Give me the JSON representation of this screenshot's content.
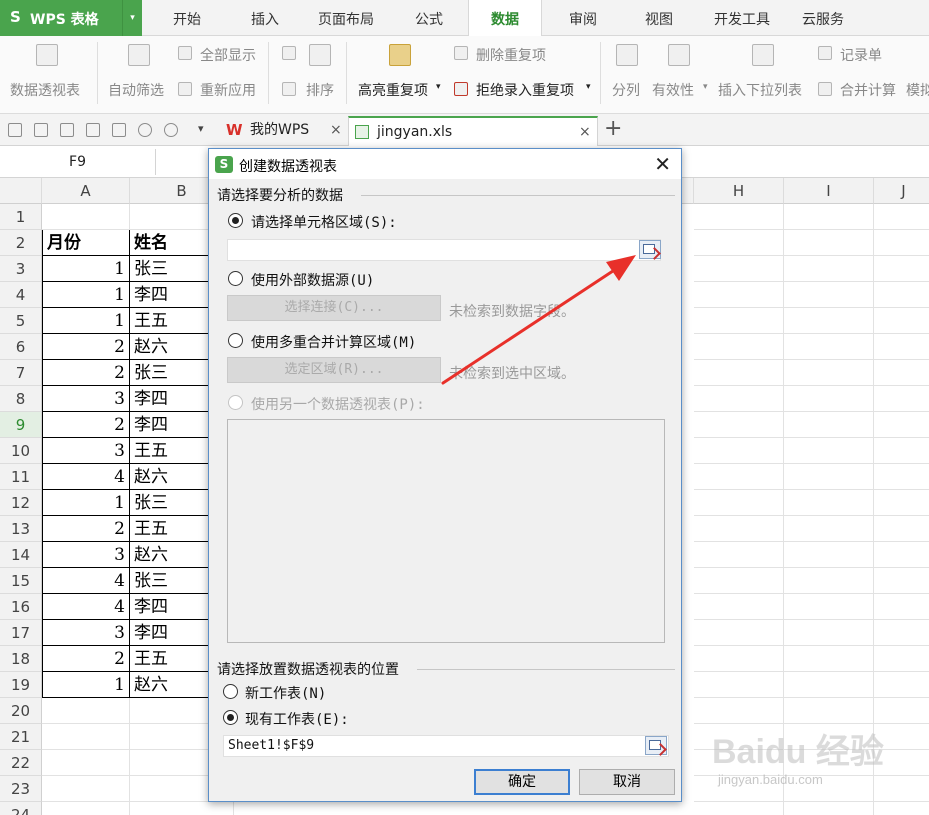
{
  "app": {
    "logo": "S",
    "name": "WPS 表格",
    "menu_arrow": "▾"
  },
  "ribbon_tabs": [
    "开始",
    "插入",
    "页面布局",
    "公式",
    "数据",
    "审阅",
    "视图",
    "开发工具",
    "云服务"
  ],
  "active_tab": "数据",
  "ribbon": {
    "pivot": "数据透视表",
    "autofilter": "自动筛选",
    "show_all": "全部显示",
    "reapply": "重新应用",
    "sort": "排序",
    "highlight_dup": "高亮重复项",
    "remove_dup": "删除重复项",
    "reject_dup": "拒绝录入重复项",
    "split": "分列",
    "validity": "有效性",
    "insert_dropdown": "插入下拉列表",
    "record": "记录单",
    "consolidate": "合并计算",
    "simulate": "模拟"
  },
  "doc_tabs": {
    "mywps": "我的WPS",
    "file": "jingyan.xls",
    "close": "×",
    "add": "+"
  },
  "formula_bar": {
    "name_box": "F9"
  },
  "columns": [
    "A",
    "B",
    "H",
    "I",
    "J"
  ],
  "rows": [
    "1",
    "2",
    "3",
    "4",
    "5",
    "6",
    "7",
    "8",
    "9",
    "10",
    "11",
    "12",
    "13",
    "14",
    "15",
    "16",
    "17",
    "18",
    "19",
    "20",
    "21",
    "22",
    "23",
    "24"
  ],
  "selected_row": "9",
  "table": {
    "headers": [
      "月份",
      "姓名"
    ],
    "data": [
      [
        "1",
        "张三"
      ],
      [
        "1",
        "李四"
      ],
      [
        "1",
        "王五"
      ],
      [
        "2",
        "赵六"
      ],
      [
        "2",
        "张三"
      ],
      [
        "3",
        "李四"
      ],
      [
        "2",
        "李四"
      ],
      [
        "3",
        "王五"
      ],
      [
        "4",
        "赵六"
      ],
      [
        "1",
        "张三"
      ],
      [
        "2",
        "王五"
      ],
      [
        "3",
        "赵六"
      ],
      [
        "4",
        "张三"
      ],
      [
        "4",
        "李四"
      ],
      [
        "3",
        "李四"
      ],
      [
        "2",
        "王五"
      ],
      [
        "1",
        "赵六"
      ]
    ]
  },
  "dialog": {
    "title": "创建数据透视表",
    "close": "✕",
    "group1": "请选择要分析的数据",
    "opt_range": "请选择单元格区域(S):",
    "range_value": "",
    "opt_external": "使用外部数据源(U)",
    "btn_connect": "选择连接(C)...",
    "hint_connect": "未检索到数据字段。",
    "opt_multi": "使用多重合并计算区域(M)",
    "btn_select_range": "选定区域(R)...",
    "hint_select_range": "未检索到选中区域。",
    "opt_other_pivot": "使用另一个数据透视表(P):",
    "group2": "请选择放置数据透视表的位置",
    "opt_new_sheet": "新工作表(N)",
    "opt_existing_sheet": "现有工作表(E):",
    "location_value": "Sheet1!$F$9",
    "ok": "确定",
    "cancel": "取消"
  },
  "watermark": {
    "brand": "Baidu 经验",
    "url": "jingyan.baidu.com"
  },
  "colors": {
    "accent": "#4aa44d",
    "arrow": "#e8302a",
    "dialog_border": "#5a8ec8"
  }
}
